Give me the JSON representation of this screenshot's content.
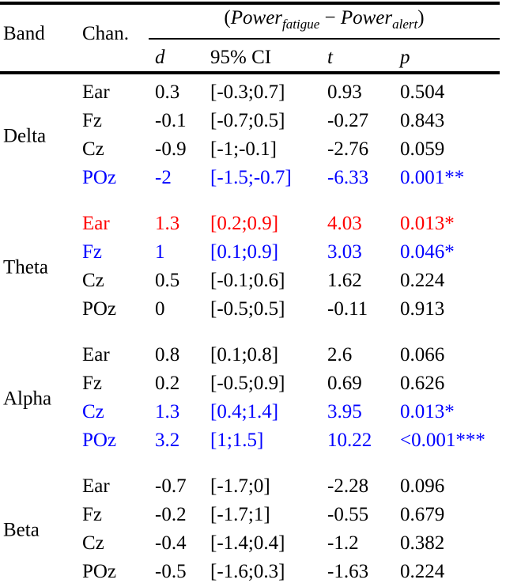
{
  "header": {
    "band_label": "Band",
    "chan_label": "Chan.",
    "formula": {
      "open_paren": "(",
      "power1": "Power",
      "sub1": "fatigue",
      "minus": "−",
      "power2": "Power",
      "sub2": "alert",
      "close_paren": ")",
      "full_text": "(Power_fatigue − Power_alert)"
    },
    "subcols": {
      "d": "d",
      "ci": "95% CI",
      "t": "t",
      "p": "p"
    }
  },
  "colors": {
    "default": "#000000",
    "significant_blue": "#0000FF",
    "significant_red": "#FF0000"
  },
  "bands": [
    {
      "name": "Delta",
      "rows": [
        {
          "chan": "Ear",
          "d": "0.3",
          "ci": "[-0.3;0.7]",
          "t": "0.93",
          "p": "0.504",
          "color": "#000000"
        },
        {
          "chan": "Fz",
          "d": "-0.1",
          "ci": "[-0.7;0.5]",
          "t": "-0.27",
          "p": "0.843",
          "color": "#000000"
        },
        {
          "chan": "Cz",
          "d": "-0.9",
          "ci": "[-1;-0.1]",
          "t": "-2.76",
          "p": "0.059",
          "color": "#000000"
        },
        {
          "chan": "POz",
          "d": "-2",
          "ci": "[-1.5;-0.7]",
          "t": "-6.33",
          "p": "0.001**",
          "color": "#0000FF"
        }
      ]
    },
    {
      "name": "Theta",
      "rows": [
        {
          "chan": "Ear",
          "d": "1.3",
          "ci": "[0.2;0.9]",
          "t": "4.03",
          "p": "0.013*",
          "color": "#FF0000"
        },
        {
          "chan": "Fz",
          "d": "1",
          "ci": "[0.1;0.9]",
          "t": "3.03",
          "p": "0.046*",
          "color": "#0000FF"
        },
        {
          "chan": "Cz",
          "d": "0.5",
          "ci": "[-0.1;0.6]",
          "t": "1.62",
          "p": "0.224",
          "color": "#000000"
        },
        {
          "chan": "POz",
          "d": "0",
          "ci": "[-0.5;0.5]",
          "t": "-0.11",
          "p": "0.913",
          "color": "#000000"
        }
      ]
    },
    {
      "name": "Alpha",
      "rows": [
        {
          "chan": "Ear",
          "d": "0.8",
          "ci": "[0.1;0.8]",
          "t": "2.6",
          "p": "0.066",
          "color": "#000000"
        },
        {
          "chan": "Fz",
          "d": "0.2",
          "ci": "[-0.5;0.9]",
          "t": "0.69",
          "p": "0.626",
          "color": "#000000"
        },
        {
          "chan": "Cz",
          "d": "1.3",
          "ci": "[0.4;1.4]",
          "t": "3.95",
          "p": "0.013*",
          "color": "#0000FF"
        },
        {
          "chan": "POz",
          "d": "3.2",
          "ci": "[1;1.5]",
          "t": "10.22",
          "p": "<0.001***",
          "color": "#0000FF"
        }
      ]
    },
    {
      "name": "Beta",
      "rows": [
        {
          "chan": "Ear",
          "d": "-0.7",
          "ci": "[-1.7;0]",
          "t": "-2.28",
          "p": "0.096",
          "color": "#000000"
        },
        {
          "chan": "Fz",
          "d": "-0.2",
          "ci": "[-1.7;1]",
          "t": "-0.55",
          "p": "0.679",
          "color": "#000000"
        },
        {
          "chan": "Cz",
          "d": "-0.4",
          "ci": "[-1.4;0.4]",
          "t": "-1.2",
          "p": "0.382",
          "color": "#000000"
        },
        {
          "chan": "POz",
          "d": "-0.5",
          "ci": "[-1.6;0.3]",
          "t": "-1.63",
          "p": "0.224",
          "color": "#000000"
        }
      ]
    }
  ]
}
